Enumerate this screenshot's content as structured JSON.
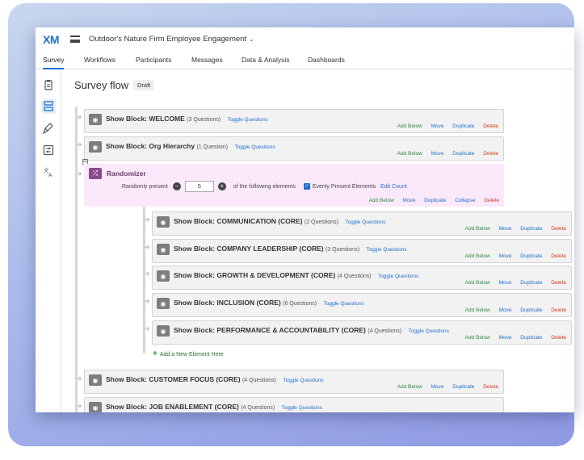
{
  "app": {
    "logo": "XM",
    "project_title": "Outdoor's Nature Firm Employee Engagement",
    "project_chevron": "⌄"
  },
  "tabs": [
    {
      "label": "Survey",
      "active": true
    },
    {
      "label": "Workflows"
    },
    {
      "label": "Participants"
    },
    {
      "label": "Messages"
    },
    {
      "label": "Data & Analysis"
    },
    {
      "label": "Dashboards"
    }
  ],
  "rail_icons": [
    "survey-icon",
    "survey-flow-icon",
    "look-and-feel-icon",
    "survey-options-icon",
    "translate-icon"
  ],
  "page": {
    "title": "Survey flow",
    "status": "Draft"
  },
  "actions": {
    "add_below": "Add Below",
    "move": "Move",
    "duplicate": "Duplicate",
    "collapse": "Collapse",
    "delete": "Delete"
  },
  "blocks_top": [
    {
      "prefix": "Show Block:",
      "name": "WELCOME",
      "count": "(3 Questions)",
      "toggle": "Toggle Questions"
    },
    {
      "prefix": "Show Block:",
      "name": "Org Hierarchy",
      "count": "(1 Question)",
      "toggle": "Toggle Questions"
    }
  ],
  "randomizer": {
    "collapse_symbol": "⊟",
    "title": "Randomizer",
    "present_label": "Randomly present",
    "present_value": "5",
    "following_label": "of the following elements",
    "evenly_label": "Evenly Present Elements",
    "edit_count": "Edit Count"
  },
  "blocks_nested": [
    {
      "prefix": "Show Block:",
      "name": "COMMUNICATION (CORE)",
      "count": "(2 Questions)",
      "toggle": "Toggle Questions"
    },
    {
      "prefix": "Show Block:",
      "name": "COMPANY LEADERSHIP (CORE)",
      "count": "(3 Questions)",
      "toggle": "Toggle Questions"
    },
    {
      "prefix": "Show Block:",
      "name": "GROWTH & DEVELOPMENT (CORE)",
      "count": "(4 Questions)",
      "toggle": "Toggle Questions"
    },
    {
      "prefix": "Show Block:",
      "name": "INCLUSION (CORE)",
      "count": "(6 Questions)",
      "toggle": "Toggle Questions"
    },
    {
      "prefix": "Show Block:",
      "name": "PERFORMANCE & ACCOUNTABILITY (CORE)",
      "count": "(4 Questions)",
      "toggle": "Toggle Questions"
    }
  ],
  "add_new_element": "Add a New Element Here",
  "blocks_bottom": [
    {
      "prefix": "Show Block:",
      "name": "CUSTOMER FOCUS (CORE)",
      "count": "(4 Questions)",
      "toggle": "Toggle Questions"
    },
    {
      "prefix": "Show Block:",
      "name": "JOB ENABLEMENT (CORE)",
      "count": "(4 Questions)",
      "toggle": "Toggle Questions"
    }
  ],
  "colors": {
    "accent": "#1f6fd1",
    "add_green": "#2b8a3e",
    "delete_red": "#d0391a",
    "randomizer_bg": "#fbe9fb",
    "randomizer_icon": "#8a4a8a"
  }
}
